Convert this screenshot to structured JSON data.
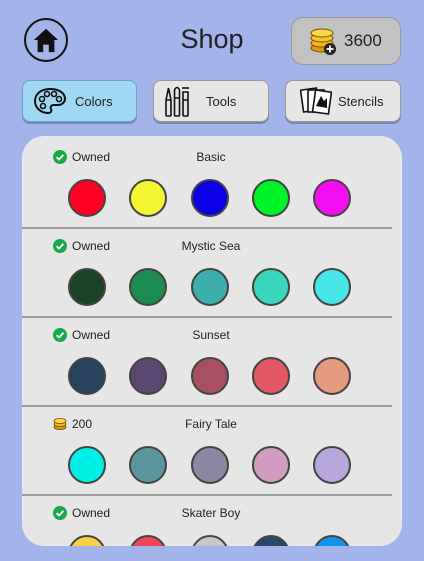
{
  "header": {
    "home_icon": "home-icon",
    "title": "Shop",
    "coins": "3600",
    "coin_icon": "coin-stack-plus-icon"
  },
  "tabs": [
    {
      "label": "Colors",
      "icon": "palette-icon",
      "active": true
    },
    {
      "label": "Tools",
      "icon": "brushes-icon",
      "active": false
    },
    {
      "label": "Stencils",
      "icon": "stencils-icon",
      "active": false
    }
  ],
  "palettes": [
    {
      "status": "Owned",
      "owned": true,
      "name": "Basic",
      "colors": [
        "#ff0022",
        "#f5f533",
        "#0b00e8",
        "#00f528",
        "#f20ef0"
      ]
    },
    {
      "status": "Owned",
      "owned": true,
      "name": "Mystic Sea",
      "colors": [
        "#1b4325",
        "#1b8b4f",
        "#3eaeac",
        "#3ad5bd",
        "#46e6e6"
      ]
    },
    {
      "status": "Owned",
      "owned": true,
      "name": "Sunset",
      "colors": [
        "#27425f",
        "#5b4870",
        "#a94f64",
        "#e15964",
        "#e49a7c"
      ]
    },
    {
      "status": "200",
      "owned": false,
      "name": "Fairy Tale",
      "colors": [
        "#00f0e8",
        "#5a969e",
        "#8a88a4",
        "#d29cc0",
        "#b6a6da"
      ]
    },
    {
      "status": "Owned",
      "owned": true,
      "name": "Skater Boy",
      "colors": [
        "#f4d145",
        "#ef4454",
        "#c8c8c8",
        "#27476b",
        "#1193e8"
      ]
    }
  ]
}
